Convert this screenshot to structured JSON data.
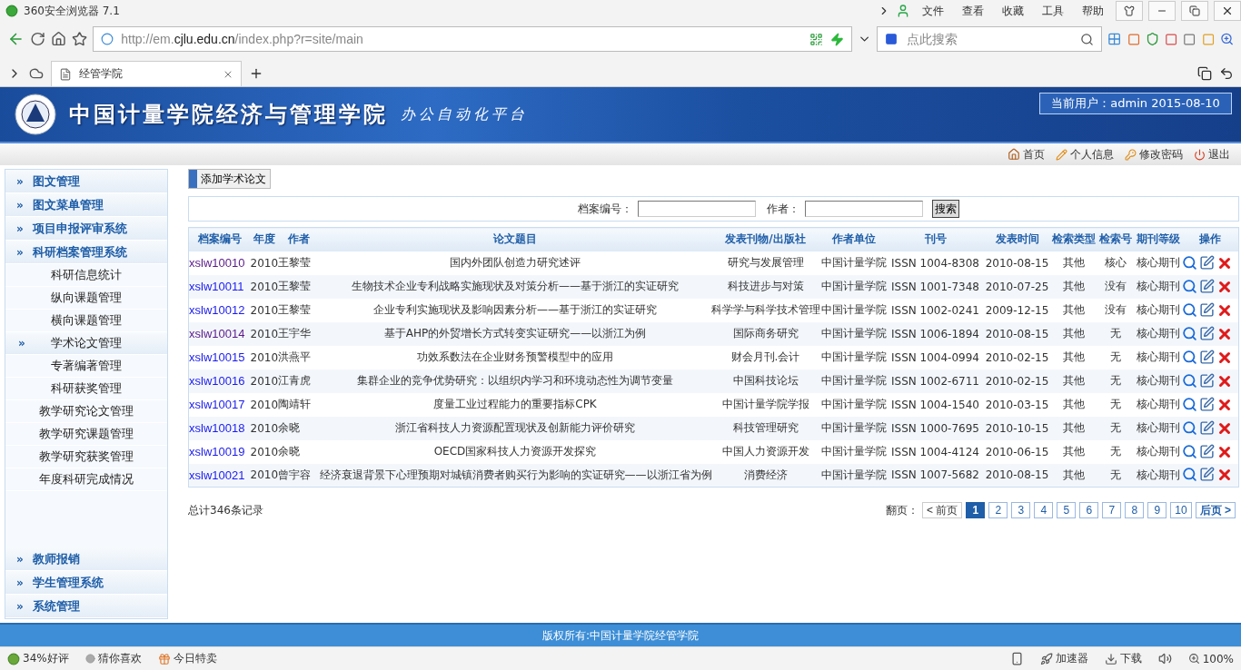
{
  "browser": {
    "title": "360安全浏览器 7.1",
    "menu": [
      "文件",
      "查看",
      "收藏",
      "工具",
      "帮助"
    ],
    "url": "http://em.**cjlu.edu.cn**/index.php?r=site/main",
    "search": {
      "placeholder": "点此搜索"
    },
    "tabs": [
      {
        "label": "经管学院",
        "selected": true
      }
    ]
  },
  "header": {
    "title": "中国计量学院经济与管理学院",
    "subtitle": "办公自动化平台",
    "current_user": "当前用户：admin 2015-08-10"
  },
  "toolbar": [
    {
      "kind": "home",
      "label": "首页"
    },
    {
      "kind": "profile",
      "label": "个人信息"
    },
    {
      "kind": "password",
      "label": "修改密码"
    },
    {
      "kind": "logout",
      "label": "退出"
    }
  ],
  "sidebar": {
    "top_groups": [
      {
        "marker": "»",
        "label": "图文管理"
      },
      {
        "marker": "»",
        "label": "图文菜单管理"
      },
      {
        "marker": "»",
        "label": "项目申报评审系统"
      },
      {
        "marker": "»",
        "label": "科研档案管理系统",
        "children": [
          {
            "label": "科研信息统计",
            "selected": false
          },
          {
            "label": "纵向课题管理",
            "selected": false
          },
          {
            "label": "横向课题管理",
            "selected": false
          },
          {
            "marker": "»",
            "label": "学术论文管理",
            "selected": true
          },
          {
            "label": "专著编著管理",
            "selected": false
          },
          {
            "label": "科研获奖管理",
            "selected": false
          },
          {
            "label": "教学研究论文管理",
            "selected": false
          },
          {
            "label": "教学研究课题管理",
            "selected": false
          },
          {
            "label": "教学研究获奖管理",
            "selected": false
          },
          {
            "label": "年度科研完成情况",
            "selected": false
          }
        ]
      }
    ],
    "bottom_groups": [
      {
        "marker": "»",
        "label": "教师报销"
      },
      {
        "marker": "»",
        "label": "学生管理系统"
      },
      {
        "marker": "»",
        "label": "系统管理"
      }
    ]
  },
  "add_button": "添加学术论文",
  "search_form": {
    "fields": [
      {
        "label": "档案编号："
      },
      {
        "label": "作者："
      }
    ],
    "button": "搜索"
  },
  "table": {
    "columns": [
      "档案编号",
      "年度",
      "作者",
      "论文题目",
      "发表刊物/出版社",
      "作者单位",
      "刊号",
      "发表时间",
      "检索类型",
      "检索号",
      "期刊等级",
      "操作"
    ],
    "rows": [
      {
        "visited": true,
        "cells": [
          "xslw10010",
          "2010",
          "王黎莹",
          "国内外团队创造力研究述评",
          "研究与发展管理",
          "中国计量学院",
          "ISSN 1004-8308",
          "2010-08-15",
          "其他",
          "核心",
          "核心期刊"
        ]
      },
      {
        "visited": false,
        "cells": [
          "xslw10011",
          "2010",
          "王黎莹",
          "生物技术企业专利战略实施现状及对策分析——基于浙江的实证研究",
          "科技进步与对策",
          "中国计量学院",
          "ISSN 1001-7348",
          "2010-07-25",
          "其他",
          "没有",
          "核心期刊"
        ]
      },
      {
        "visited": false,
        "cells": [
          "xslw10012",
          "2010",
          "王黎莹",
          "企业专利实施现状及影响因素分析——基于浙江的实证研究",
          "科学学与科学技术管理",
          "中国计量学院",
          "ISSN 1002-0241",
          "2009-12-15",
          "其他",
          "没有",
          "核心期刊"
        ]
      },
      {
        "visited": true,
        "cells": [
          "xslw10014",
          "2010",
          "王宇华",
          "基于AHP的外贸增长方式转变实证研究——以浙江为例",
          "国际商务研究",
          "中国计量学院",
          "ISSN 1006-1894",
          "2010-08-15",
          "其他",
          "无",
          "核心期刊"
        ]
      },
      {
        "visited": false,
        "cells": [
          "xslw10015",
          "2010",
          "洪燕平",
          "功效系数法在企业财务预警模型中的应用",
          "财会月刊.会计",
          "中国计量学院",
          "ISSN 1004-0994",
          "2010-02-15",
          "其他",
          "无",
          "核心期刊"
        ]
      },
      {
        "visited": false,
        "cells": [
          "xslw10016",
          "2010",
          "江青虎",
          "集群企业的竞争优势研究：以组织内学习和环境动态性为调节变量",
          "中国科技论坛",
          "中国计量学院",
          "ISSN 1002-6711",
          "2010-02-15",
          "其他",
          "无",
          "核心期刊"
        ]
      },
      {
        "visited": false,
        "cells": [
          "xslw10017",
          "2010",
          "陶靖轩",
          "度量工业过程能力的重要指标CPK",
          "中国计量学院学报",
          "中国计量学院",
          "ISSN 1004-1540",
          "2010-03-15",
          "其他",
          "无",
          "核心期刊"
        ]
      },
      {
        "visited": false,
        "cells": [
          "xslw10018",
          "2010",
          "余晓",
          "浙江省科技人力资源配置现状及创新能力评价研究",
          "科技管理研究",
          "中国计量学院",
          "ISSN 1000-7695",
          "2010-10-15",
          "其他",
          "无",
          "核心期刊"
        ]
      },
      {
        "visited": false,
        "cells": [
          "xslw10019",
          "2010",
          "余晓",
          "OECD国家科技人力资源开发探究",
          "中国人力资源开发",
          "中国计量学院",
          "ISSN 1004-4124",
          "2010-06-15",
          "其他",
          "无",
          "核心期刊"
        ]
      },
      {
        "visited": false,
        "cells": [
          "xslw10021",
          "2010",
          "曾宇容",
          "经济衰退背景下心理预期对城镇消费者购买行为影响的实证研究——以浙江省为例",
          "消费经济",
          "中国计量学院",
          "ISSN 1007-5682",
          "2010-08-15",
          "其他",
          "无",
          "核心期刊"
        ]
      }
    ]
  },
  "total": "总计346条记录",
  "pagination": {
    "label": "翻页：",
    "prev": "< 前页",
    "pages": [
      {
        "label": "1",
        "selected": true
      },
      {
        "label": "2",
        "selected": false
      },
      {
        "label": "3",
        "selected": false
      },
      {
        "label": "4",
        "selected": false
      },
      {
        "label": "5",
        "selected": false
      },
      {
        "label": "6",
        "selected": false
      },
      {
        "label": "7",
        "selected": false
      },
      {
        "label": "8",
        "selected": false
      },
      {
        "label": "9",
        "selected": false
      },
      {
        "label": "10",
        "selected": false
      }
    ],
    "next": "后页 >"
  },
  "footer": "版权所有:中国计量学院经管学院",
  "status_bar": {
    "left": [
      {
        "kind": "rating",
        "label": "34%好评"
      },
      {
        "kind": "guess",
        "label": "猜你喜欢"
      },
      {
        "kind": "sale",
        "label": "今日特卖"
      }
    ],
    "right": [
      {
        "kind": "speed",
        "label": "加速器"
      },
      {
        "kind": "download",
        "label": "下载"
      }
    ],
    "zoom": "100%"
  }
}
